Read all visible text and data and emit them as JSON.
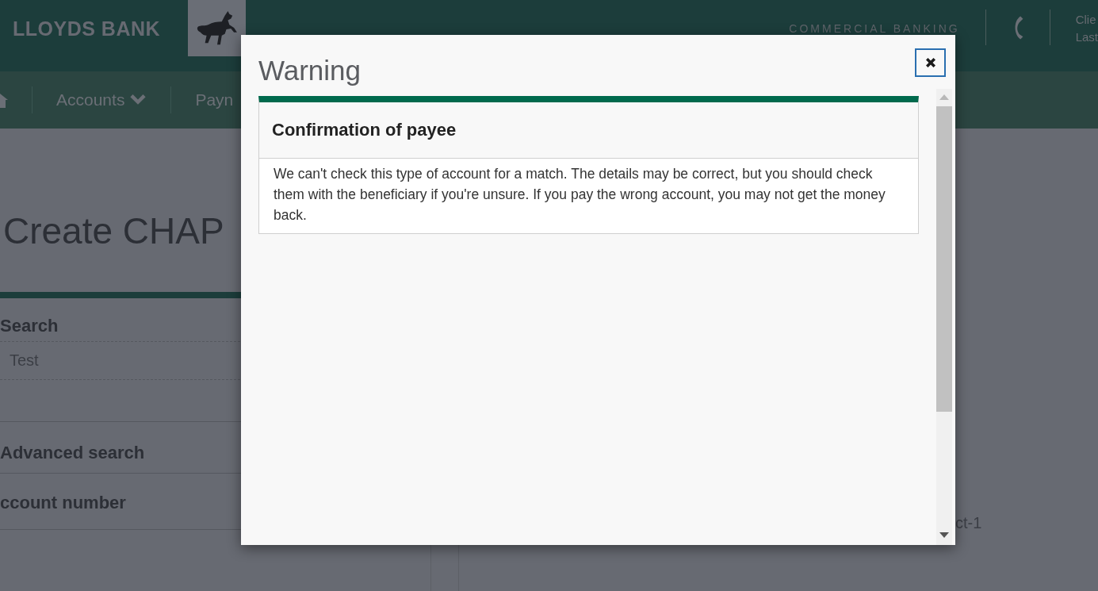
{
  "header": {
    "brand": "LLOYDS BANK",
    "division": "COMMERCIAL BANKING",
    "client_lines": [
      "Clie",
      "Last"
    ]
  },
  "nav": {
    "items": [
      {
        "label": "Accounts",
        "has_menu": true
      },
      {
        "label": "Payn",
        "has_menu": false
      }
    ]
  },
  "page": {
    "title": "Create CHAP",
    "search": {
      "heading": "Search",
      "value": "Test"
    },
    "advanced_search": "Advanced search",
    "account_number_label": "ccount number",
    "column_text": "ct-1"
  },
  "modal": {
    "title": "Warning",
    "panel": {
      "heading": "Confirmation of payee",
      "body": "We can't check this type of account for a match. The details may be correct, but you should check them with the beneficiary if you're unsure. If you pay the wrong account, you may not get the money back."
    }
  }
}
